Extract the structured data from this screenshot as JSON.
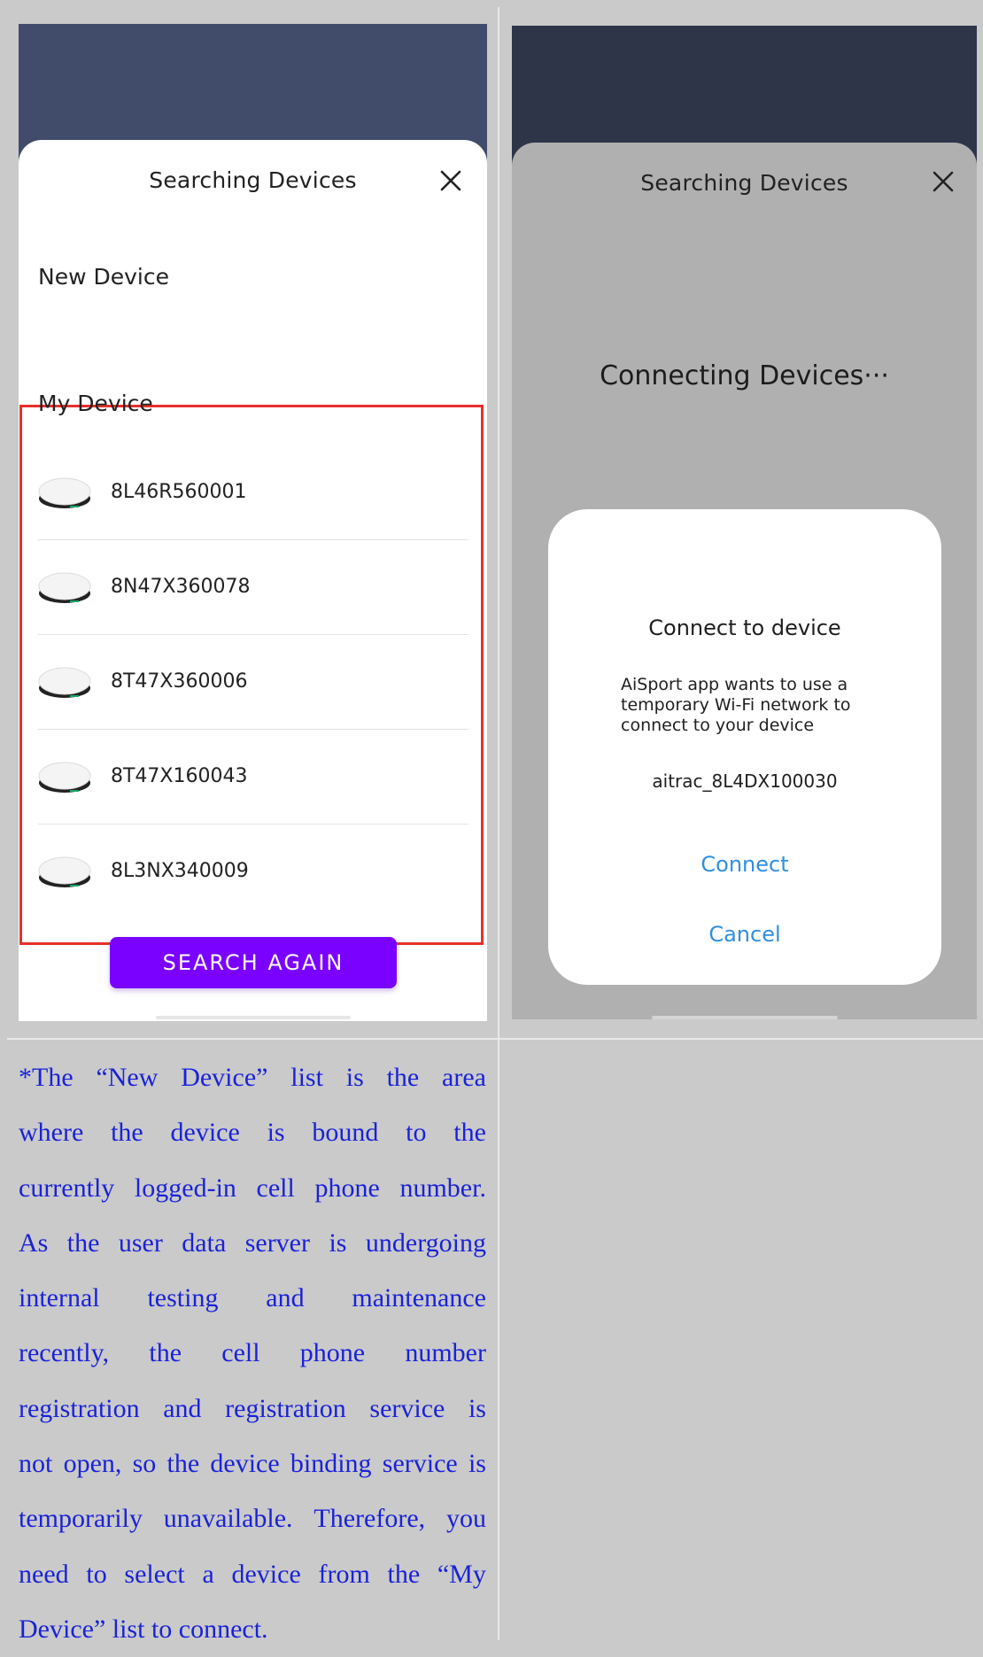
{
  "left_screen": {
    "sheet_title": "Searching Devices",
    "new_device_label": "New Device",
    "my_device_label": "My Device",
    "devices": [
      {
        "name": "8L46R560001"
      },
      {
        "name": "8N47X360078"
      },
      {
        "name": "8T47X360006"
      },
      {
        "name": "8T47X160043"
      },
      {
        "name": "8L3NX340009"
      }
    ],
    "search_again_label": "SEARCH AGAIN",
    "highlight_color": "#e8302a",
    "button_color": "#7a00ff"
  },
  "right_screen": {
    "sheet_title": "Searching Devices",
    "connecting_text": "Connecting Devices···",
    "dialog": {
      "title": "Connect to device",
      "body": "AiSport app wants to use a temporary Wi-Fi network to connect to your device",
      "ssid": "aitrac_8L4DX100030",
      "connect_label": "Connect",
      "cancel_label": "Cancel",
      "action_color": "#2f8fe0"
    }
  },
  "caption": {
    "lines": [
      "*The “New Device” list is the area",
      "where the device is bound to the",
      "currently logged-in cell phone number.",
      "As the user data server is undergoing",
      "internal testing and maintenance",
      "recently, the cell phone number",
      "registration and registration service is",
      "not open, so the device binding service is",
      "temporarily unavailable. Therefore, you",
      "need to select a device from the “My",
      "Device” list to connect."
    ],
    "color": "#1a22d8"
  }
}
